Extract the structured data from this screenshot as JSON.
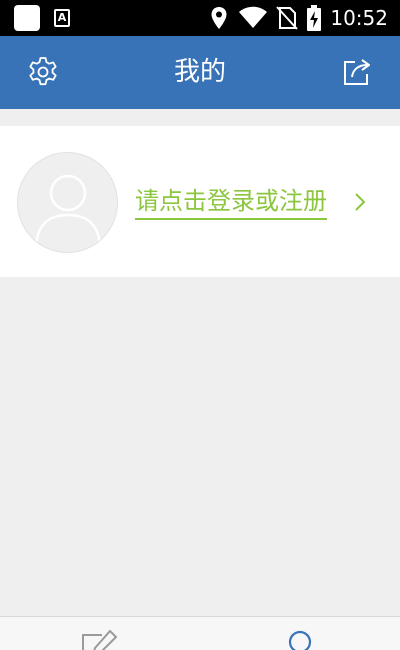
{
  "status_bar": {
    "time": "10:52",
    "notification_letter": "A"
  },
  "header": {
    "title": "我的",
    "left_icon": "gear-icon",
    "right_icon": "share-icon"
  },
  "profile": {
    "login_text": "请点击登录或注册",
    "avatar_icon": "user-avatar-icon"
  },
  "bottom_nav": {
    "items": [
      {
        "icon": "edit-icon"
      },
      {
        "icon": "profile-circle-icon",
        "active": true
      }
    ]
  },
  "colors": {
    "app_bar": "#3873b7",
    "accent_green": "#8cc63e",
    "background": "#efefef",
    "active_nav": "#3873b7"
  }
}
